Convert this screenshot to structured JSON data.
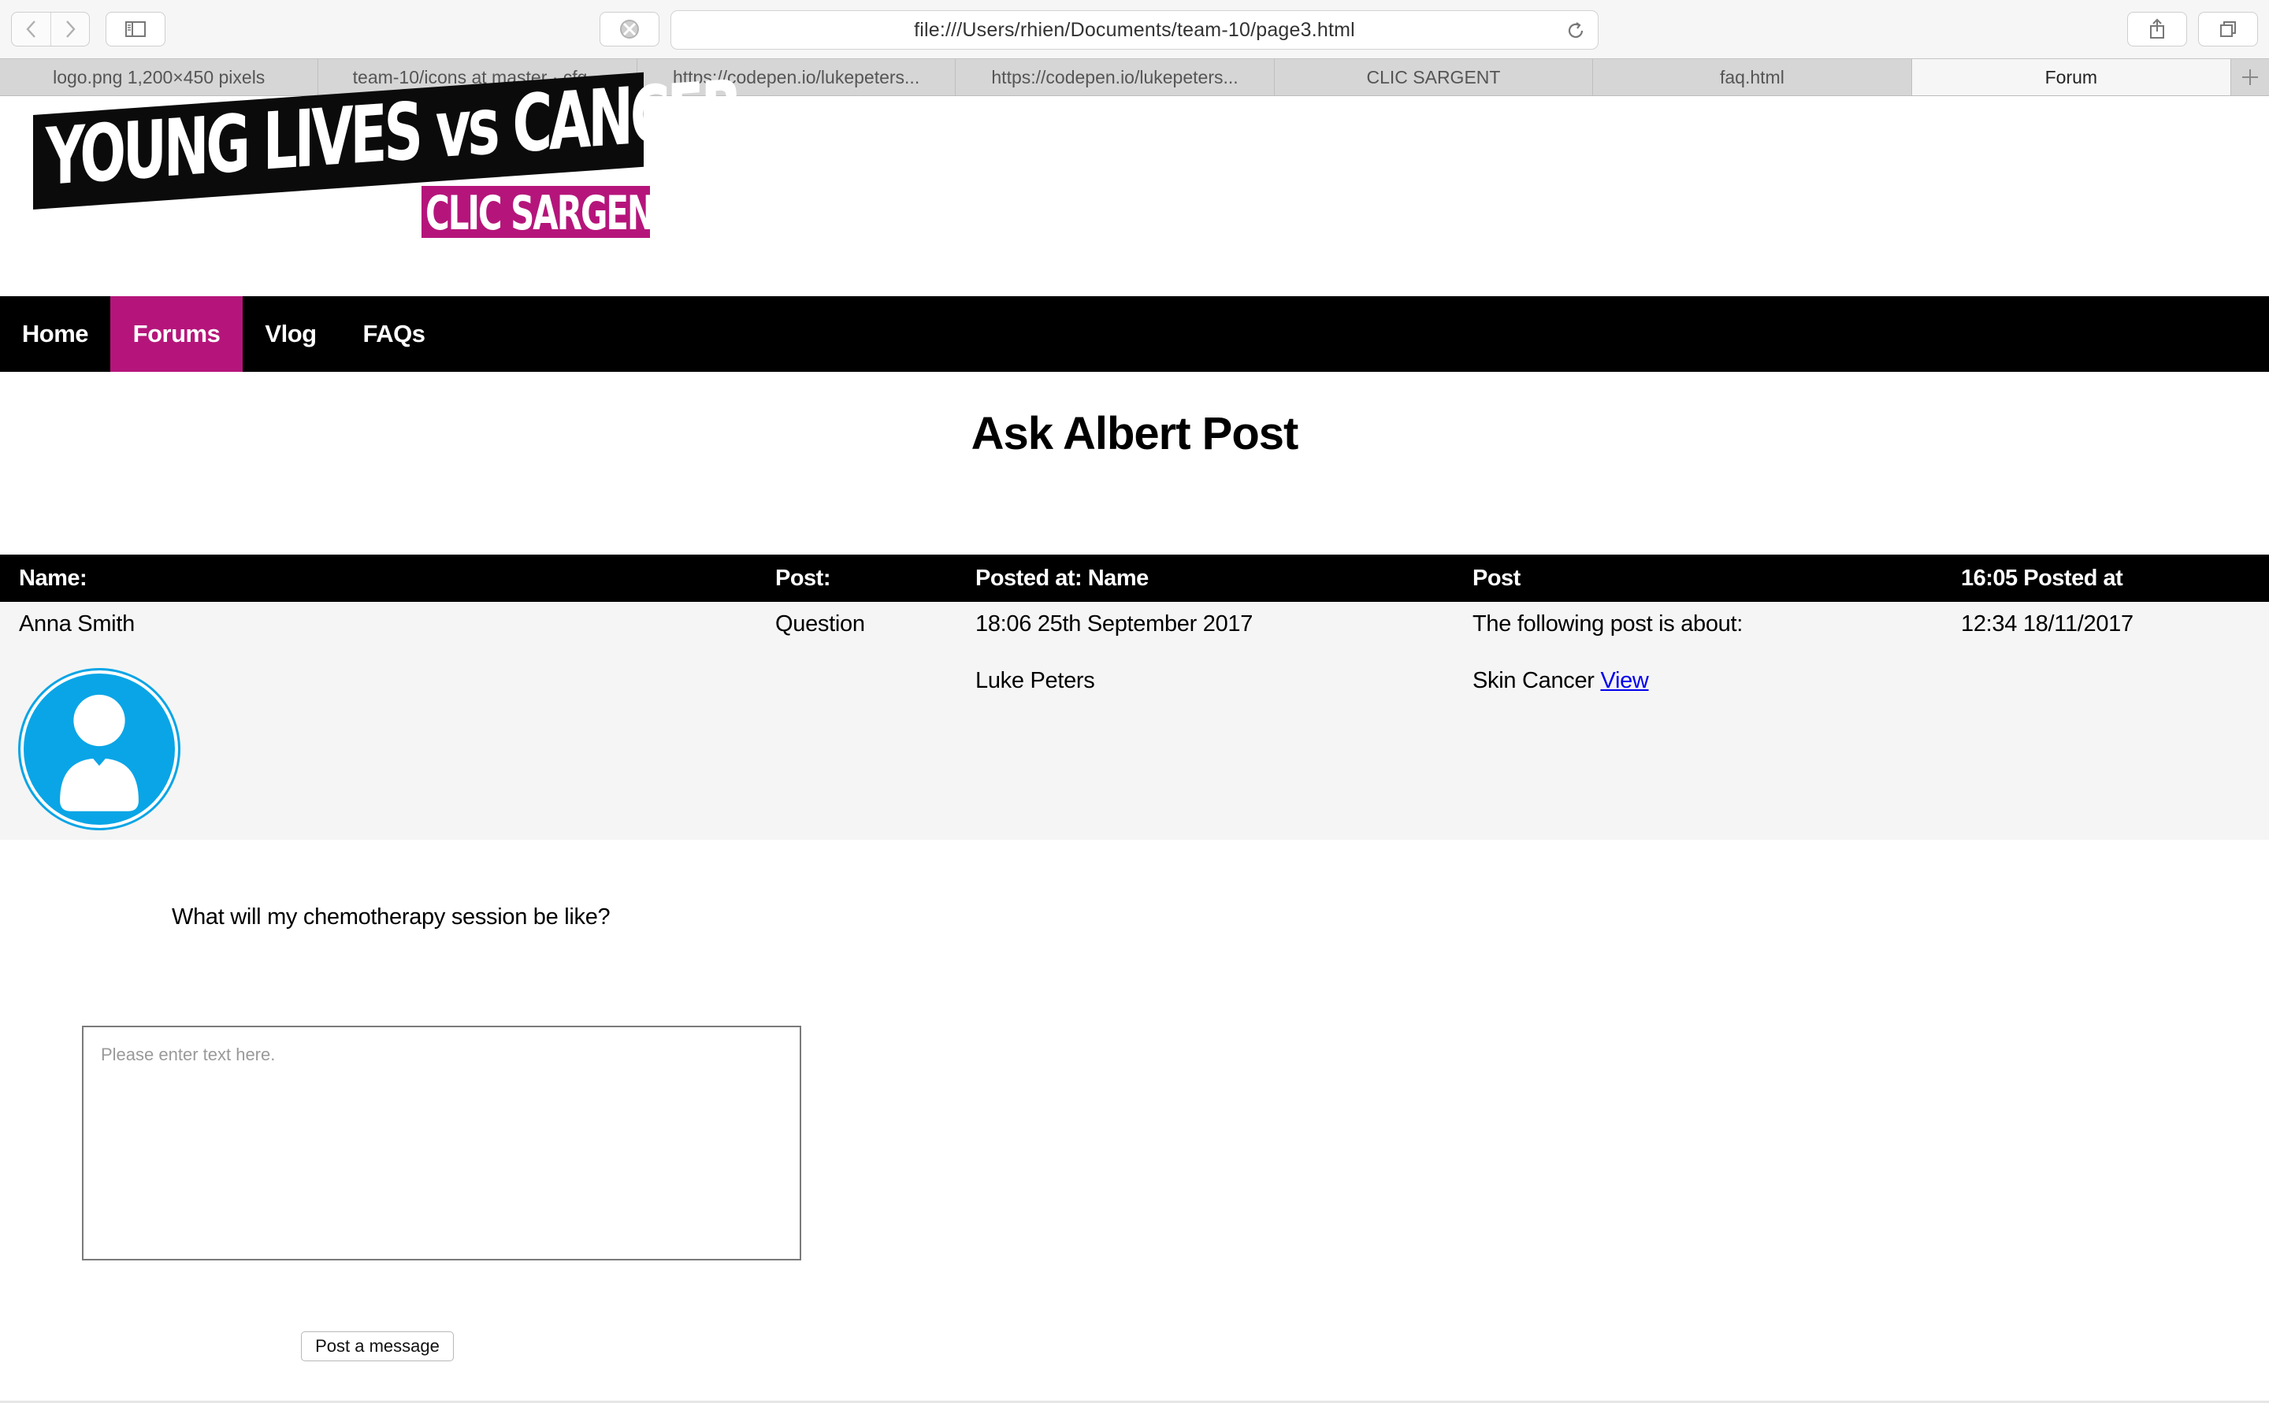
{
  "browser": {
    "url": "file:///Users/rhien/Documents/team-10/page3.html",
    "tabs": [
      {
        "label": "logo.png 1,200×450 pixels"
      },
      {
        "label": "team-10/icons at master · cfg..."
      },
      {
        "label": "https://codepen.io/lukepeters..."
      },
      {
        "label": "https://codepen.io/lukepeters..."
      },
      {
        "label": "CLIC SARGENT"
      },
      {
        "label": "faq.html"
      },
      {
        "label": "Forum",
        "active": true
      }
    ]
  },
  "logo": {
    "line1": "YOUNG LIVES vs CANCER",
    "line2": "CLIC SARGENT",
    "brand_pink": "#b5157b"
  },
  "nav": {
    "items": [
      {
        "label": "Home"
      },
      {
        "label": "Forums",
        "active": true
      },
      {
        "label": "Vlog"
      },
      {
        "label": "FAQs"
      }
    ]
  },
  "page_title": "Ask Albert Post",
  "table": {
    "headers": [
      "Name:",
      "Post:",
      "Posted at: Name",
      "Post",
      "16:05 Posted at"
    ],
    "row1": [
      "Anna Smith",
      "Question",
      "18:06 25th September 2017",
      "The following post is about:",
      "12:34 18/11/2017"
    ],
    "row2": {
      "name": "Luke Peters",
      "topic": "Skin Cancer",
      "link": "View"
    },
    "avatar_icon": "user-avatar-icon",
    "avatar_color": "#0aa5e6"
  },
  "question_text": "What will my chemotherapy session be like?",
  "message": {
    "placeholder": "Please enter text here.",
    "value": ""
  },
  "post_button_label": "Post a message"
}
